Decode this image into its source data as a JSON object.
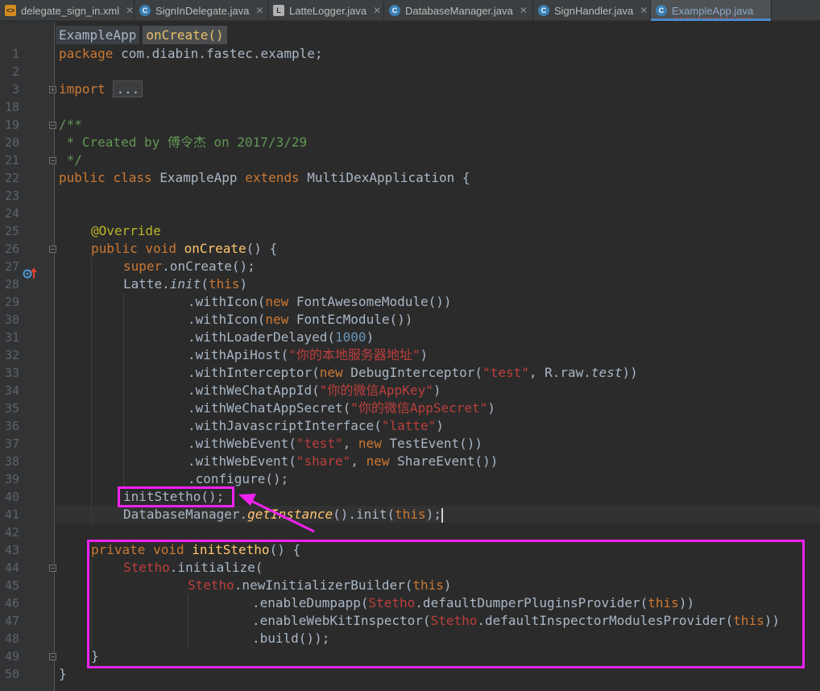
{
  "tabs": [
    {
      "label": "delegate_sign_in.xml",
      "icon": "xml-file-icon",
      "active": false
    },
    {
      "label": "SignInDelegate.java",
      "icon": "java-class-icon",
      "active": false
    },
    {
      "label": "LatteLogger.java",
      "icon": "java-file-icon",
      "active": false
    },
    {
      "label": "DatabaseManager.java",
      "icon": "java-class-icon",
      "active": false
    },
    {
      "label": "SignHandler.java",
      "icon": "java-class-icon",
      "active": false
    },
    {
      "label": "ExampleApp.java",
      "icon": "java-class-icon",
      "active": true
    }
  ],
  "breadcrumb": [
    "ExampleApp",
    "onCreate()"
  ],
  "line_numbers": [
    "1",
    "2",
    "3",
    "18",
    "19",
    "20",
    "21",
    "22",
    "23",
    "24",
    "25",
    "26",
    "27",
    "28",
    "29",
    "30",
    "31",
    "32",
    "33",
    "34",
    "35",
    "36",
    "37",
    "38",
    "39",
    "40",
    "41",
    "42",
    "43",
    "44",
    "45",
    "46",
    "47",
    "48",
    "49",
    "50"
  ],
  "code": {
    "l1_a": "package",
    "l1_b": " com.diabin.fastec.example;",
    "l3_a": "import",
    "l3_b": "...",
    "l19": "/**",
    "l20": " * Created by 傅令杰 on 2017/3/29",
    "l21": " */",
    "l22_a": "public class",
    "l22_b": " ExampleApp ",
    "l22_c": "extends",
    "l22_d": " MultiDexApplication {",
    "l25": "@Override",
    "l26_a": "public void",
    "l26_b": "onCreate",
    "l26_c": "() {",
    "l27_a": "super",
    "l27_b": ".onCreate();",
    "l28_a": "Latte.",
    "l28_b": "init",
    "l28_c": "(",
    "l28_d": "this",
    "l28_e": ")",
    "l29_a": ".withIcon(",
    "l29_b": "new",
    "l29_c": " FontAwesomeModule())",
    "l30_a": ".withIcon(",
    "l30_b": "new",
    "l30_c": " FontEcModule())",
    "l31_a": ".withLoaderDelayed(",
    "l31_b": "1000",
    "l31_c": ")",
    "l32_a": ".withApiHost(",
    "l32_b": "\"你的本地服务器地址\"",
    "l32_c": ")",
    "l33_a": ".withInterceptor(",
    "l33_b": "new",
    "l33_c": " DebugInterceptor(",
    "l33_d": "\"test\"",
    "l33_e": ", R.raw.",
    "l33_f": "test",
    "l33_g": "))",
    "l34_a": ".withWeChatAppId(",
    "l34_b": "\"你的微信AppKey\"",
    "l34_c": ")",
    "l35_a": ".withWeChatAppSecret(",
    "l35_b": "\"你的微信AppSecret\"",
    "l35_c": ")",
    "l36_a": ".withJavascriptInterface(",
    "l36_b": "\"latte\"",
    "l36_c": ")",
    "l37_a": ".withWebEvent(",
    "l37_b": "\"test\"",
    "l37_c": ", ",
    "l37_d": "new",
    "l37_e": " TestEvent())",
    "l38_a": ".withWebEvent(",
    "l38_b": "\"share\"",
    "l38_c": ", ",
    "l38_d": "new",
    "l38_e": " ShareEvent())",
    "l39": ".configure();",
    "l40": "initStetho();",
    "l41_a": "DatabaseManager.",
    "l41_b": "getInstance",
    "l41_c": "().init(",
    "l41_d": "this",
    "l41_e": ");",
    "l43_a": "private void",
    "l43_b": "initStetho",
    "l43_c": "() {",
    "l44_a": "Stetho",
    "l44_b": ".initialize(",
    "l45_a": "Stetho",
    "l45_b": ".newInitializerBuilder(",
    "l45_c": "this",
    "l45_d": ")",
    "l46_a": ".enableDumpapp(",
    "l46_b": "Stetho",
    "l46_c": ".defaultDumperPluginsProvider(",
    "l46_d": "this",
    "l46_e": "))",
    "l47_a": ".enableWebKitInspector(",
    "l47_b": "Stetho",
    "l47_c": ".defaultInspectorModulesProvider(",
    "l47_d": "this",
    "l47_e": "))",
    "l48": ".build());",
    "l49": "}",
    "l50": "}"
  },
  "colors": {
    "keyword": "#cc7832",
    "string": "#bc3f3c",
    "comment": "#629755",
    "annotation": "#bbb529",
    "method": "#ffc66d",
    "number": "#6897bb",
    "highlight": "#ee22ee"
  }
}
